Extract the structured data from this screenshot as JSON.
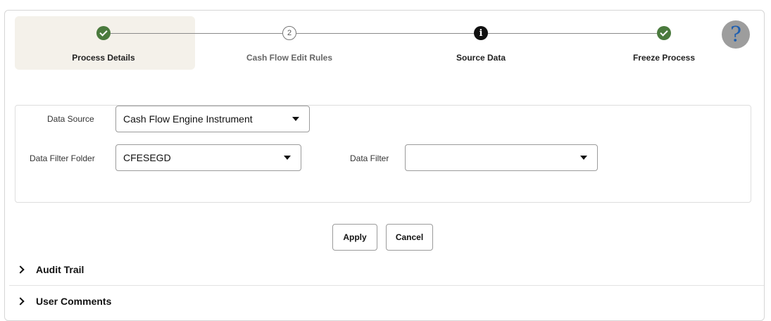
{
  "train": {
    "steps": [
      {
        "label": "Process Details",
        "state": "complete",
        "icon": "check-icon"
      },
      {
        "label": "Cash Flow Edit Rules",
        "state": "pending",
        "number": "2"
      },
      {
        "label": "Source Data",
        "state": "current",
        "icon": "info-icon",
        "glyph": "i"
      },
      {
        "label": "Freeze Process",
        "state": "complete",
        "icon": "check-icon"
      }
    ],
    "help_glyph": "?"
  },
  "form": {
    "data_source_label": "Data Source",
    "data_source_value": "Cash Flow Engine Instrument",
    "data_filter_folder_label": "Data Filter Folder",
    "data_filter_folder_value": "CFESEGD",
    "data_filter_label": "Data Filter",
    "data_filter_value": ""
  },
  "actions": {
    "apply_label": "Apply",
    "cancel_label": "Cancel"
  },
  "sections": [
    {
      "label": "Audit Trail"
    },
    {
      "label": "User Comments"
    }
  ],
  "colors": {
    "complete": "#4a7a3d",
    "current": "#111111",
    "help_bg": "#9d9d9d",
    "help_fg": "#1f5fb0"
  }
}
